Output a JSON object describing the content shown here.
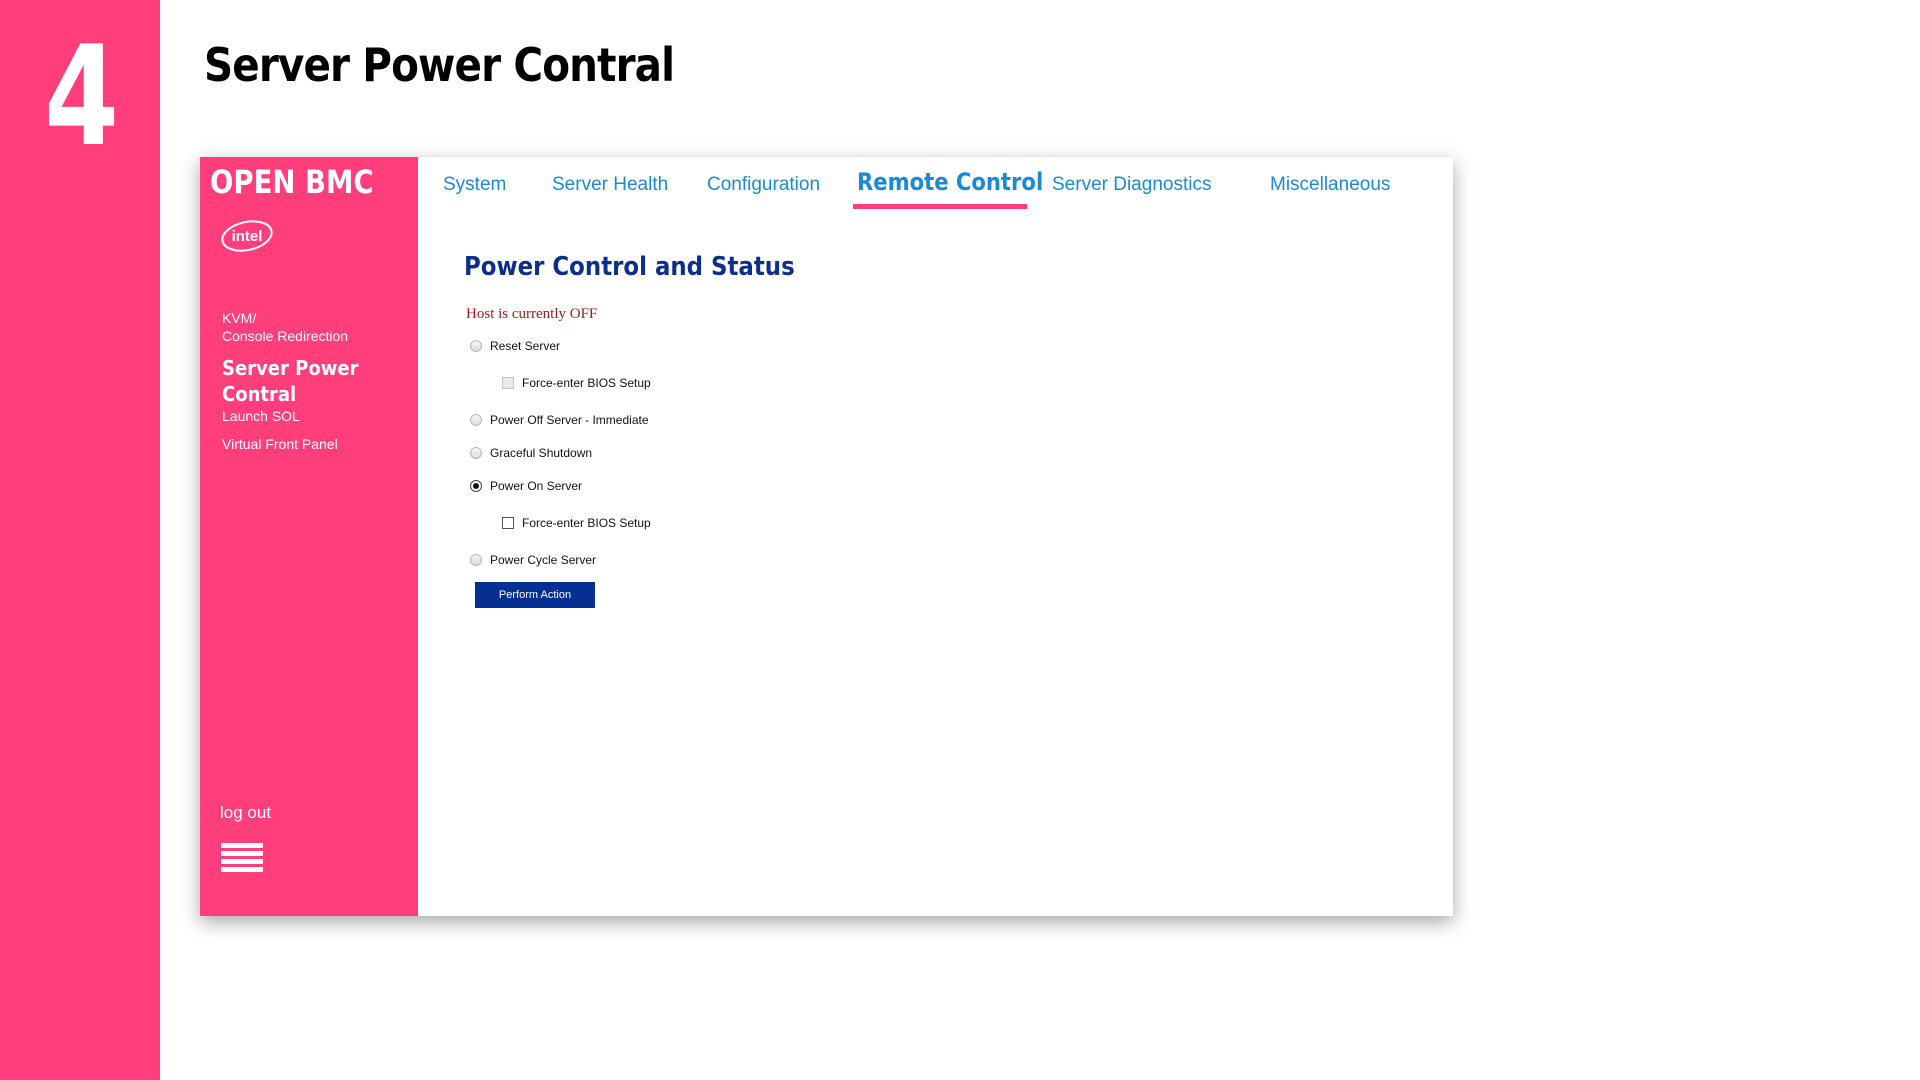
{
  "slide": {
    "step_number": "4",
    "title": "Server Power Contral"
  },
  "colors": {
    "brand_pink": "#ff3e7b",
    "tab_blue": "#1a8ad6",
    "heading_navy": "#0d2f8c",
    "status_red": "#9a1b1b",
    "button_navy": "#062f94"
  },
  "sidebar": {
    "brand": "OPEN BMC",
    "logo_icon": "intel-logo-icon",
    "logo_text": "intel",
    "items": [
      {
        "label_line1": "KVM/",
        "label_line2": "Console Redirection"
      },
      {
        "label_line1": "Server Power",
        "label_line2": "Contral"
      },
      {
        "label": "Launch SOL"
      },
      {
        "label": "Virtual Front Panel"
      }
    ],
    "logout": "log out",
    "menu_icon": "hamburger-menu-icon"
  },
  "tabs": [
    {
      "label": "System"
    },
    {
      "label": "Server Health"
    },
    {
      "label": "Configuration"
    },
    {
      "label": "Remote Control"
    },
    {
      "label": "Server Diagnostics"
    },
    {
      "label": "Miscellaneous"
    }
  ],
  "active_tab": "Remote Control",
  "content": {
    "heading": "Power Control and Status",
    "host_status": "Host is currently OFF",
    "options": [
      {
        "type": "radio",
        "label": "Reset Server",
        "checked": false
      },
      {
        "type": "checkbox",
        "label": "Force-enter BIOS Setup",
        "checked": false,
        "enabled": false
      },
      {
        "type": "radio",
        "label": "Power Off Server - Immediate",
        "checked": false
      },
      {
        "type": "radio",
        "label": "Graceful Shutdown",
        "checked": false
      },
      {
        "type": "radio",
        "label": "Power On Server",
        "checked": true
      },
      {
        "type": "checkbox",
        "label": "Force-enter BIOS Setup",
        "checked": false,
        "enabled": true
      },
      {
        "type": "radio",
        "label": "Power Cycle Server",
        "checked": false
      }
    ],
    "button_label": "Perform Action"
  }
}
